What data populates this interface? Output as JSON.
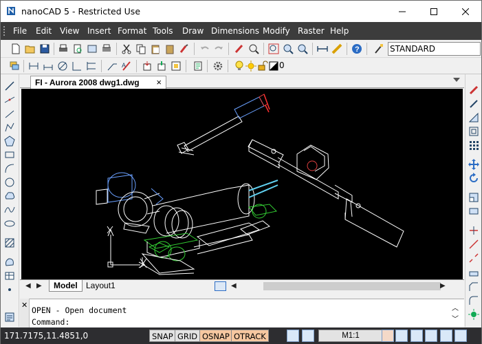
{
  "window": {
    "title": "nanoCAD 5 - Restricted Use"
  },
  "menu": [
    "File",
    "Edit",
    "View",
    "Insert",
    "Format",
    "Tools",
    "Draw",
    "Dimensions",
    "Modify",
    "Raster",
    "Help"
  ],
  "toolbar": {
    "text_style": "STANDARD",
    "layer_value": "0"
  },
  "document": {
    "tab_title": "FI - Aurora 2008 dwg1.dwg",
    "close_glyph": "×"
  },
  "layout_tabs": [
    "Model",
    "Layout1"
  ],
  "command": {
    "history": "OPEN - Open document",
    "prompt": "Command:"
  },
  "status": {
    "coordinates": "171.7175,11.4851,0",
    "snap": "SNAP",
    "grid": "GRID",
    "osnap": "OSNAP",
    "otrack": "OTRACK",
    "scale": "M1:1"
  },
  "colors": {
    "menubar": "#3c3c3c",
    "canvas": "#000000",
    "status_active": "#f6c7a0"
  }
}
